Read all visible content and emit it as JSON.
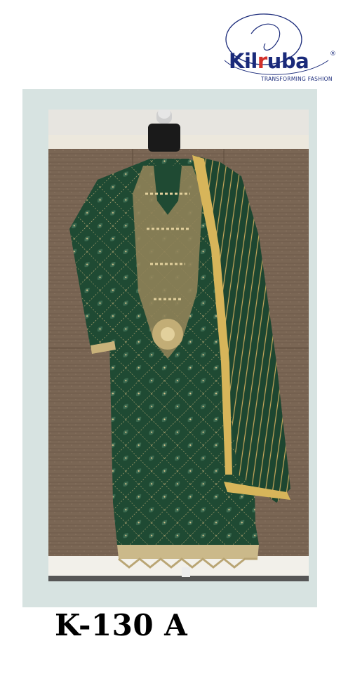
{
  "logo": {
    "brand_pre": "Kil",
    "brand_r": "r",
    "brand_post": "uba",
    "registered": "®",
    "tagline": "TRANSFORMING FASHION",
    "colors": {
      "text": "#1a2a7a",
      "accent": "#d2302a"
    }
  },
  "product": {
    "code": "K-130 A",
    "garment_color": "#1f4a33",
    "embroidery_color": "#c9b27a",
    "frame_color": "#d7e3e1"
  }
}
